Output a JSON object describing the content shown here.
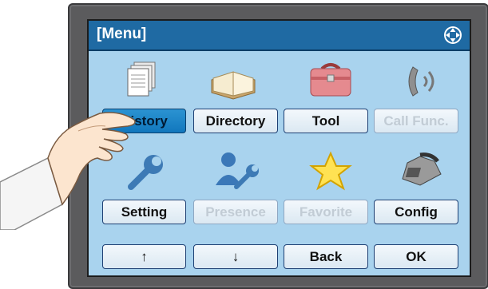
{
  "screen": {
    "title": "[Menu]"
  },
  "menu": {
    "items": [
      {
        "label": "History",
        "icon": "history-icon",
        "state": "selected"
      },
      {
        "label": "Directory",
        "icon": "directory-book-icon",
        "state": "enabled"
      },
      {
        "label": "Tool",
        "icon": "toolbox-icon",
        "state": "enabled"
      },
      {
        "label": "Call Func.",
        "icon": "call-function-icon",
        "state": "disabled"
      },
      {
        "label": "Setting",
        "icon": "wrench-icon",
        "state": "enabled"
      },
      {
        "label": "Presence",
        "icon": "presence-icon",
        "state": "disabled"
      },
      {
        "label": "Favorite",
        "icon": "star-icon",
        "state": "disabled"
      },
      {
        "label": "Config",
        "icon": "phone-icon",
        "state": "enabled"
      }
    ]
  },
  "softkeys": {
    "up": "↑",
    "down": "↓",
    "back": "Back",
    "ok": "OK"
  },
  "colors": {
    "titlebar": "#1f6aa3",
    "screen_bg": "#a9d3ee",
    "selected": "#1a86c8"
  }
}
